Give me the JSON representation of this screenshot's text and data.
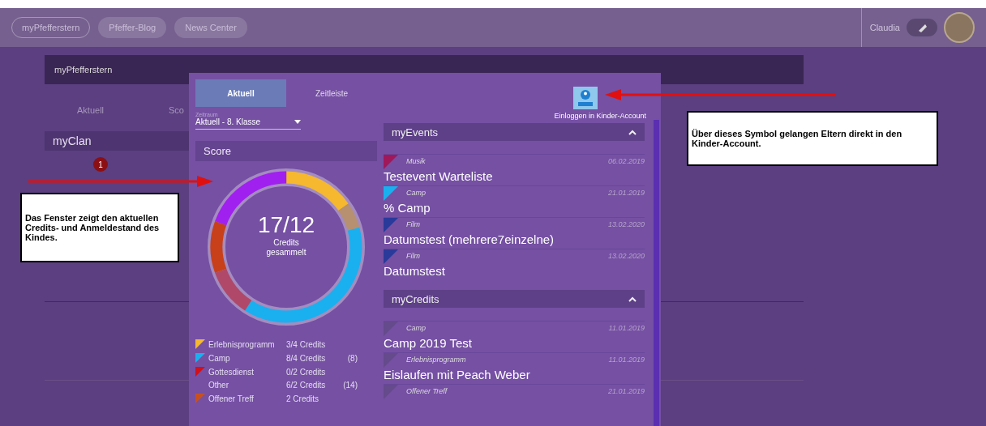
{
  "nav": {
    "links": [
      {
        "label": "myPfefferstern",
        "selected": true
      },
      {
        "label": "Pfeffer-Blog",
        "selected": false
      },
      {
        "label": "News Center",
        "selected": false
      }
    ],
    "user": "Claudia"
  },
  "page": {
    "title": "myPfefferstern",
    "tabs": [
      "Aktuell",
      "Sco"
    ],
    "clan": "myClan",
    "badge": "1"
  },
  "popup": {
    "tabs": [
      {
        "label": "Aktuell",
        "selected": true
      },
      {
        "label": "Zeitleiste",
        "selected": false
      }
    ],
    "period": {
      "label": "Zeitraum",
      "value": "Aktuell - 8. Klasse"
    },
    "score": {
      "title": "Score",
      "total": "17/12",
      "caption": "Credits gesammelt"
    },
    "legend": [
      {
        "name": "Erlebnisprogramm",
        "credits": "3/4 Credits",
        "color": "#f5b82e"
      },
      {
        "name": "Camp",
        "credits": "8/4 Credits",
        "extra": "(8)",
        "color": "#1ab0ef"
      },
      {
        "name": "Gottesdienst",
        "credits": "0/2 Credits",
        "color": "#d0101a"
      },
      {
        "name": "Other",
        "credits": "6/2 Credits",
        "extra": "(14)"
      },
      {
        "name": "Offener Treff",
        "credits": "2 Credits",
        "color": "#c8501e"
      }
    ],
    "kid_login": "Einloggen in Kinder-Account",
    "sections": [
      {
        "title": "myEvents",
        "expanded": true,
        "items": [
          {
            "category": "Musik",
            "date": "06.02.2019",
            "title": "Testevent Warteliste",
            "color": "#a0185a"
          },
          {
            "category": "Camp",
            "date": "21.01.2019",
            "title": "% Camp",
            "color": "#1ab0ef"
          },
          {
            "category": "Film",
            "date": "13.02.2020",
            "title": "Datumstest (mehrere7einzelne)",
            "color": "#2a3a9a"
          },
          {
            "category": "Film",
            "date": "13.02.2020",
            "title": "Datumstest",
            "color": "#2a3a9a"
          }
        ]
      },
      {
        "title": "myCredits",
        "expanded": true,
        "items": [
          {
            "category": "Camp",
            "date": "11.01.2019",
            "title": "Camp 2019 Test",
            "color": "#654a8c"
          },
          {
            "category": "Erlebnisprogramm",
            "date": "11.01.2019",
            "title": "Eislaufen mit Peach Weber",
            "color": "#654a8c"
          },
          {
            "category": "Offener Treff",
            "date": "21.01.2019",
            "color": "#654a8c"
          }
        ]
      }
    ]
  },
  "notes": [
    "Das Fenster zeigt den aktuellen Credits- und Anmeldestand des Kindes.",
    "Über dieses Symbol gelangen Eltern direkt in den Kinder-Account."
  ]
}
